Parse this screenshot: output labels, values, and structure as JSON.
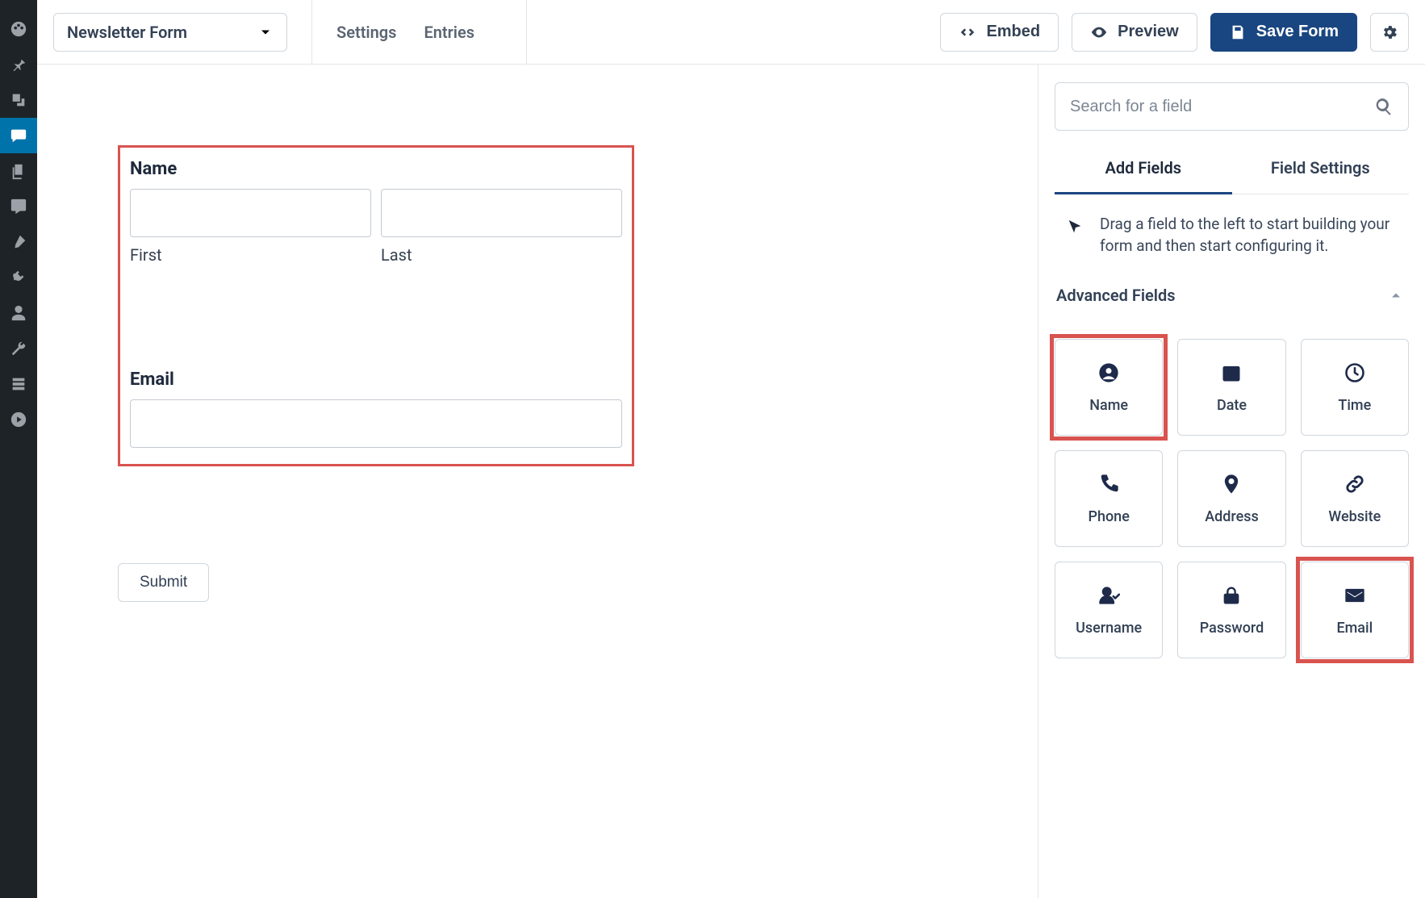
{
  "topbar": {
    "form_name": "Newsletter Form",
    "tab_settings": "Settings",
    "tab_entries": "Entries",
    "embed": "Embed",
    "preview": "Preview",
    "save": "Save Form"
  },
  "canvas": {
    "name_label": "Name",
    "first_sub": "First",
    "last_sub": "Last",
    "email_label": "Email",
    "submit": "Submit"
  },
  "panel": {
    "search_placeholder": "Search for a field",
    "tab_add": "Add Fields",
    "tab_settings": "Field Settings",
    "hint": "Drag a field to the left to start building your form and then start configuring it.",
    "section": "Advanced Fields",
    "fields": [
      {
        "label": "Name",
        "icon": "user-circle",
        "highlight": true
      },
      {
        "label": "Date",
        "icon": "calendar",
        "highlight": false
      },
      {
        "label": "Time",
        "icon": "clock",
        "highlight": false
      },
      {
        "label": "Phone",
        "icon": "phone",
        "highlight": false
      },
      {
        "label": "Address",
        "icon": "pin",
        "highlight": false
      },
      {
        "label": "Website",
        "icon": "link",
        "highlight": false
      },
      {
        "label": "Username",
        "icon": "user-check",
        "highlight": false
      },
      {
        "label": "Password",
        "icon": "lock",
        "highlight": false
      },
      {
        "label": "Email",
        "icon": "mail",
        "highlight": true
      }
    ]
  }
}
